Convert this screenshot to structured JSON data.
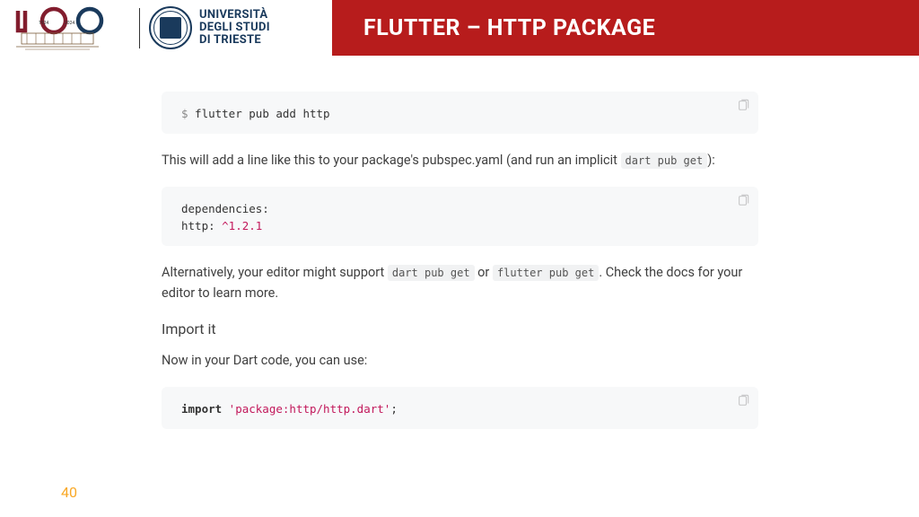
{
  "header": {
    "logo_years": {
      "left": "1924",
      "right": "2024"
    },
    "university": {
      "line1": "UNIVERSITÀ",
      "line2": "DEGLI STUDI",
      "line3": "DI TRIESTE"
    },
    "title": "FLUTTER – HTTP PACKAGE"
  },
  "content": {
    "code1_prompt": "$",
    "code1_cmd": " flutter pub add http",
    "para1_a": "This will add a line like this to your package's pubspec.yaml (and run an implicit ",
    "para1_code": "dart pub get",
    "para1_b": "):",
    "code2_line1": "dependencies:",
    "code2_line2_a": "  http: ",
    "code2_line2_b": "^1.2.1",
    "para2_a": "Alternatively, your editor might support ",
    "para2_code1": "dart pub get",
    "para2_b": " or ",
    "para2_code2": "flutter pub get",
    "para2_c": ". Check the docs for your editor to learn more.",
    "heading": "Import it",
    "para3": "Now in your Dart code, you can use:",
    "code3_keyword": "import",
    "code3_string": " 'package:http/http.dart'",
    "code3_end": ";",
    "page_number": "40"
  }
}
